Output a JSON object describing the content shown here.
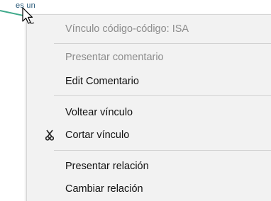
{
  "background": {
    "link_text": "es un"
  },
  "menu": {
    "items": [
      {
        "label": "Vínculo código-código: ISA",
        "enabled": false
      },
      {
        "label": "Presentar comentario",
        "enabled": false
      },
      {
        "label": "Edit Comentario",
        "enabled": true
      },
      {
        "label": "Voltear vínculo",
        "enabled": true
      },
      {
        "label": "Cortar vínculo",
        "enabled": true,
        "icon": "scissors-icon"
      },
      {
        "label": "Presentar relación",
        "enabled": true
      },
      {
        "label": "Cambiar relación",
        "enabled": true
      }
    ]
  },
  "colors": {
    "menu_background": "#f2f2f2",
    "disabled_text": "#8c8c8c",
    "enabled_text": "#111111",
    "link_line": "#3ea98a"
  }
}
